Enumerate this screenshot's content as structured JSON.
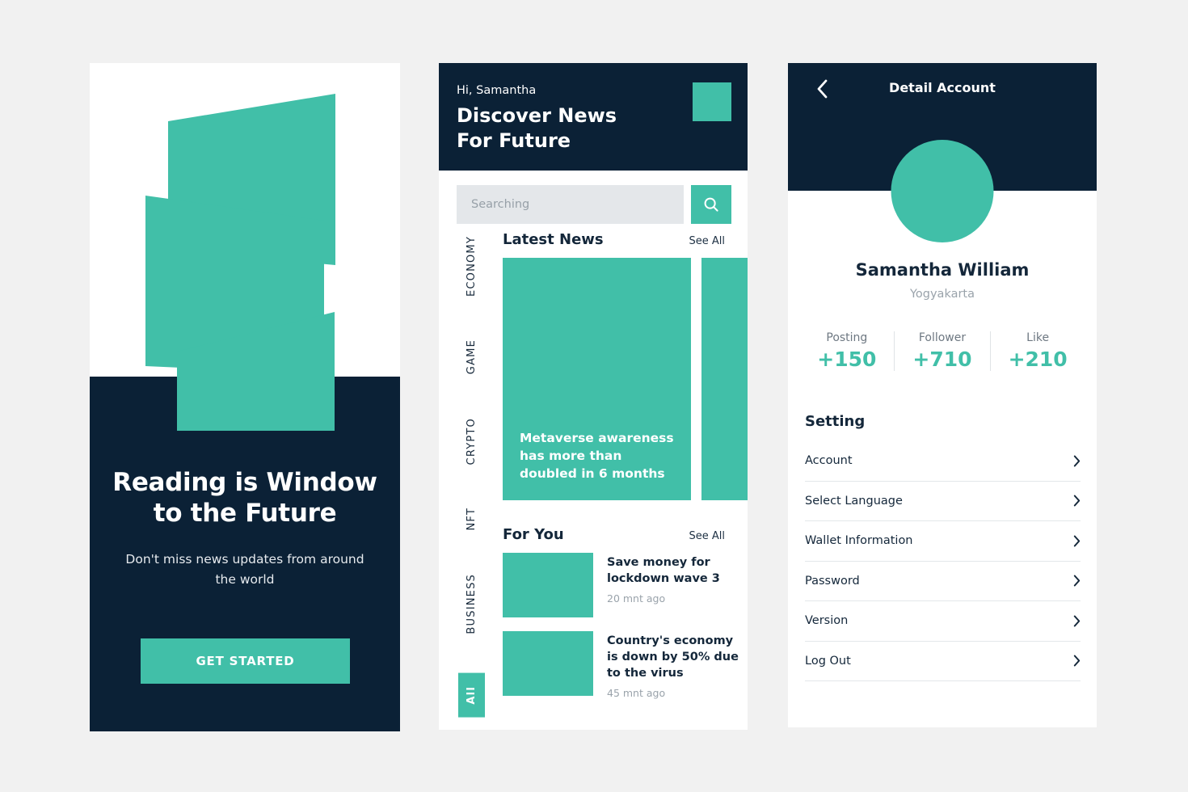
{
  "theme": {
    "teal": "#41bfa8",
    "navy": "#0b2136",
    "page_bg": "#f1f1f1"
  },
  "onboarding": {
    "title": "Reading is Window to the Future",
    "subtitle": "Don't miss news updates from around the world",
    "cta_label": "GET STARTED"
  },
  "discover": {
    "greeting": "Hi, Samantha",
    "title": "Discover News For Future",
    "search": {
      "placeholder": "Searching",
      "value": ""
    },
    "categories": [
      {
        "label": "ECONOMY",
        "active": false
      },
      {
        "label": "GAME",
        "active": false
      },
      {
        "label": "CRYPTO",
        "active": false
      },
      {
        "label": "NFT",
        "active": false
      },
      {
        "label": "BUSINESS",
        "active": false
      },
      {
        "label": "All",
        "active": true
      }
    ],
    "latest": {
      "section_title": "Latest News",
      "see_all": "See All",
      "cards": [
        {
          "headline": "Metaverse awareness has more than doubled in 6 months"
        },
        {
          "headline": ""
        }
      ]
    },
    "for_you": {
      "section_title": "For You",
      "see_all": "See All",
      "items": [
        {
          "title": "Save money for lockdown wave 3",
          "time": "20 mnt ago"
        },
        {
          "title": "Country's economy is down by 50% due to the virus",
          "time": "45 mnt ago"
        }
      ]
    }
  },
  "account": {
    "header_title": "Detail Account",
    "name": "Samantha William",
    "location": "Yogyakarta",
    "stats": [
      {
        "label": "Posting",
        "value": "+150"
      },
      {
        "label": "Follower",
        "value": "+710"
      },
      {
        "label": "Like",
        "value": "+210"
      }
    ],
    "setting_title": "Setting",
    "setting_items": [
      {
        "label": "Account"
      },
      {
        "label": "Select Language"
      },
      {
        "label": "Wallet Information"
      },
      {
        "label": "Password"
      },
      {
        "label": "Version"
      },
      {
        "label": "Log Out"
      }
    ]
  }
}
